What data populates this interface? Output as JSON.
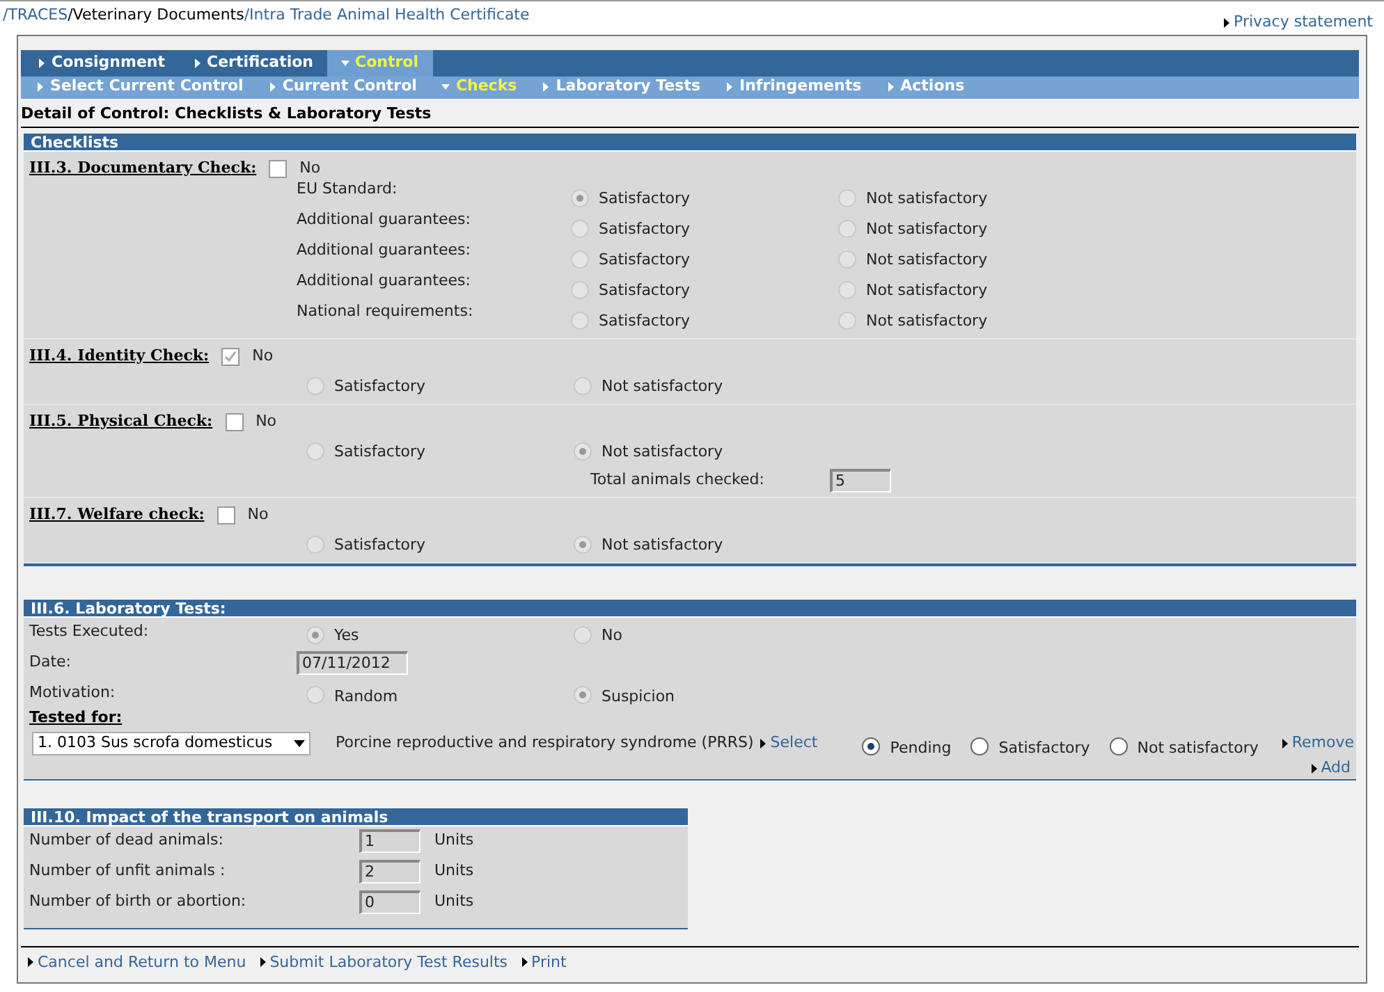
{
  "breadcrumb": [
    {
      "text": "/TRACES",
      "link": true
    },
    {
      "text": "/Veterinary Documents",
      "link": false
    },
    {
      "text": "/Intra Trade Animal Health Certificate",
      "link": true
    }
  ],
  "privacy_link": "Privacy statement",
  "tabs": [
    {
      "label": "Consignment",
      "selected": false
    },
    {
      "label": "Certification",
      "selected": false
    },
    {
      "label": "Control",
      "selected": true
    }
  ],
  "subtabs": [
    {
      "label": "Select Current Control",
      "selected": false
    },
    {
      "label": "Current Control",
      "selected": false
    },
    {
      "label": "Checks",
      "selected": true
    },
    {
      "label": "Laboratory Tests",
      "selected": false
    },
    {
      "label": "Infringements",
      "selected": false
    },
    {
      "label": "Actions",
      "selected": false
    }
  ],
  "page_title": "Detail of Control: Checklists & Laboratory Tests",
  "checklists": {
    "title": "Checklists",
    "checks": [
      {
        "kind": "documentary",
        "label": "III.3. Documentary Check:",
        "checkbox_label": "No",
        "checked": false,
        "rows": [
          {
            "label": "EU Standard:",
            "options": [
              {
                "label": "Satisfactory",
                "selected": true
              },
              {
                "label": "Not satisfactory",
                "selected": false
              }
            ]
          },
          {
            "label": "Additional guarantees:",
            "options": [
              {
                "label": "Satisfactory",
                "selected": false
              },
              {
                "label": "Not satisfactory",
                "selected": false
              }
            ]
          },
          {
            "label": "Additional guarantees:",
            "options": [
              {
                "label": "Satisfactory",
                "selected": false
              },
              {
                "label": "Not satisfactory",
                "selected": false
              }
            ]
          },
          {
            "label": "Additional guarantees:",
            "options": [
              {
                "label": "Satisfactory",
                "selected": false
              },
              {
                "label": "Not satisfactory",
                "selected": false
              }
            ]
          },
          {
            "label": "National requirements:",
            "options": [
              {
                "label": "Satisfactory",
                "selected": false
              },
              {
                "label": "Not satisfactory",
                "selected": false
              }
            ]
          }
        ]
      },
      {
        "kind": "simple",
        "label": "III.4. Identity Check:",
        "checkbox_label": "No",
        "checked": true,
        "options": [
          {
            "label": "Satisfactory",
            "selected": false
          },
          {
            "label": "Not satisfactory",
            "selected": false
          }
        ]
      },
      {
        "kind": "simple",
        "label": "III.5. Physical Check:",
        "checkbox_label": "No",
        "checked": false,
        "options": [
          {
            "label": "Satisfactory",
            "selected": false
          },
          {
            "label": "Not satisfactory",
            "selected": true
          }
        ],
        "total": {
          "label": "Total animals checked:",
          "value": "5"
        }
      },
      {
        "kind": "simple",
        "label": "III.7. Welfare check:",
        "checkbox_label": "No",
        "checked": false,
        "options": [
          {
            "label": "Satisfactory",
            "selected": false
          },
          {
            "label": "Not satisfactory",
            "selected": true
          }
        ]
      }
    ]
  },
  "lab_tests": {
    "title": "III.6. Laboratory Tests:",
    "executed": {
      "label": "Tests Executed:",
      "options": [
        {
          "label": "Yes",
          "selected": true
        },
        {
          "label": "No",
          "selected": false
        }
      ]
    },
    "date": {
      "label": "Date:",
      "value": "07/11/2012"
    },
    "motivation": {
      "label": "Motivation:",
      "options": [
        {
          "label": "Random",
          "selected": false
        },
        {
          "label": "Suspicion",
          "selected": true
        }
      ]
    },
    "tested_for": {
      "label": "Tested for:",
      "species": "1. 0103 Sus scrofa domesticus",
      "disease": "Porcine reproductive and respiratory syndrome (PRRS)",
      "select_link": "Select",
      "results": [
        {
          "label": "Pending",
          "selected": true
        },
        {
          "label": "Satisfactory",
          "selected": false
        },
        {
          "label": "Not satisfactory",
          "selected": false
        }
      ],
      "remove_link": "Remove",
      "add_link": "Add"
    }
  },
  "transport": {
    "title": "III.10. Impact of the transport on animals",
    "rows": [
      {
        "label": "Number of dead animals:",
        "value": "1",
        "unit": "Units"
      },
      {
        "label": "Number of unfit animals :",
        "value": "2",
        "unit": "Units"
      },
      {
        "label": "Number of birth or abortion:",
        "value": "0",
        "unit": "Units"
      }
    ]
  },
  "footer_links": [
    "Cancel and Return to Menu",
    "Submit Laboratory Test Results",
    "Print"
  ]
}
